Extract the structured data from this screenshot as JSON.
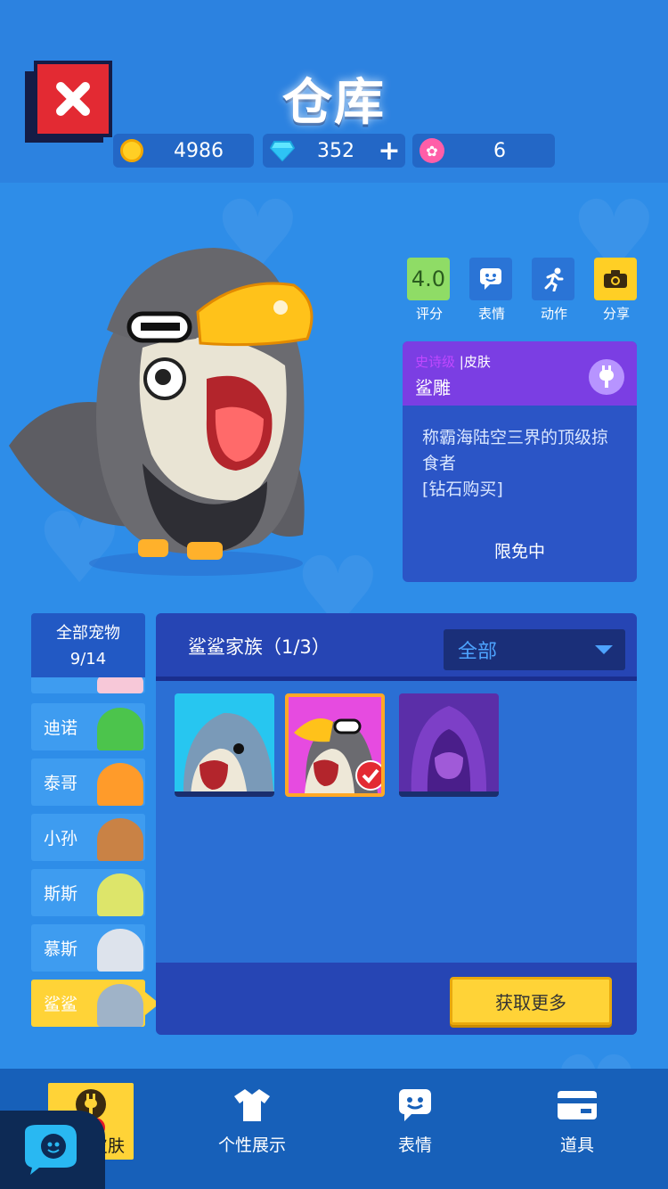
{
  "header": {
    "title": "仓库",
    "currencies": [
      {
        "icon": "coin-icon",
        "value": "4986"
      },
      {
        "icon": "diamond-icon",
        "value": "352"
      },
      {
        "icon": "lotus-icon",
        "value": "6"
      }
    ],
    "add_label": "+"
  },
  "actions": [
    {
      "label": "评分",
      "value": "4.0",
      "icon": "rating-icon"
    },
    {
      "label": "表情",
      "icon": "emote-icon"
    },
    {
      "label": "动作",
      "icon": "run-icon"
    },
    {
      "label": "分享",
      "icon": "camera-icon"
    }
  ],
  "skin_card": {
    "rarity": "史诗级",
    "separator": "|",
    "type": "皮肤",
    "name": "鲨雕",
    "description_line1": "称霸海陆空三界的顶级掠",
    "description_line2": "食者",
    "description_line3": "[钻石购买]",
    "status": "限免中"
  },
  "pet_list": {
    "all_label": "全部宠物",
    "all_count": "9/14",
    "items": [
      {
        "name": "迪诺"
      },
      {
        "name": "泰哥"
      },
      {
        "name": "小孙"
      },
      {
        "name": "斯斯"
      },
      {
        "name": "慕斯"
      },
      {
        "name": "鲨鲨",
        "active": true
      }
    ]
  },
  "skin_panel": {
    "family": "鲨鲨家族（1/3）",
    "filter": "全部",
    "more_button": "获取更多"
  },
  "nav": {
    "items": [
      {
        "label": "宠物皮肤",
        "icon": "plug-icon",
        "active": true
      },
      {
        "label": "个性展示",
        "icon": "shirt-icon"
      },
      {
        "label": "表情",
        "icon": "emote-icon"
      },
      {
        "label": "道具",
        "icon": "card-icon"
      }
    ]
  },
  "colors": {
    "background": "#2e8de8",
    "accent_yellow": "#ffd337",
    "close_red": "#e32a33",
    "epic_purple": "#7b3ee3"
  }
}
